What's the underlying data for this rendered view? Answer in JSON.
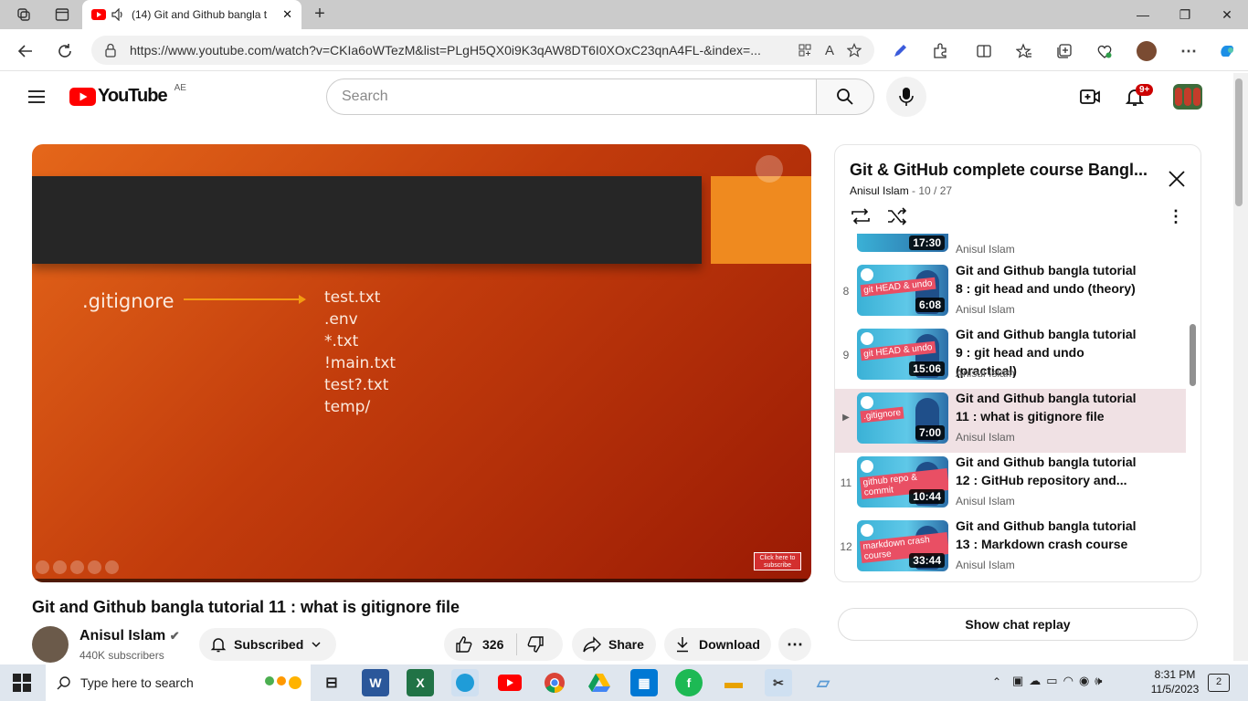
{
  "browser": {
    "tab_title": "(14) Git and Github bangla t",
    "url": "https://www.youtube.com/watch?v=CKIa6oWTezM&list=PLgH5QX0i9K3qAW8DT6I0XOxC23qnA4FL-&index=...",
    "close_tab": "✕",
    "new_tab": "+",
    "minimize": "—",
    "maximize": "❐",
    "close_window": "✕"
  },
  "youtube": {
    "logo_text": "YouTube",
    "country_code": "AE",
    "search_placeholder": "Search",
    "notification_count": "9+"
  },
  "video": {
    "slide_heading": ".gitignore",
    "slide_files": [
      "test.txt",
      ".env",
      "*.txt",
      "!main.txt",
      "test?.txt",
      "temp/"
    ],
    "subscribe_overlay": "Click here to subscribe",
    "title": "Git and Github bangla tutorial 11 : what is gitignore file",
    "channel": "Anisul Islam",
    "subscribers": "440K subscribers",
    "subscribed_label": "Subscribed",
    "likes": "326",
    "share_label": "Share",
    "download_label": "Download"
  },
  "playlist": {
    "title": "Git & GitHub complete course Bangl...",
    "owner": "Anisul Islam",
    "position": "10 / 27",
    "partial_item": {
      "duration": "17:30",
      "channel": "Anisul Islam"
    },
    "items": [
      {
        "num": "8",
        "thumb_label": "git HEAD & undo",
        "duration": "6:08",
        "title": "Git and Github bangla tutorial 8 : git head and undo (theory)",
        "channel": "Anisul Islam"
      },
      {
        "num": "9",
        "thumb_label": "git HEAD & undo",
        "duration": "15:06",
        "title": "Git and Github bangla tutorial 9 : git head and undo (practical)",
        "channel": "Anisul Islam"
      },
      {
        "num": "▶",
        "thumb_label": ".gitignore",
        "duration": "7:00",
        "title": "Git and Github bangla tutorial 11 : what is gitignore file",
        "channel": "Anisul Islam"
      },
      {
        "num": "11",
        "thumb_label": "github repo & commit",
        "duration": "10:44",
        "title": "Git and Github bangla tutorial 12 : GitHub repository and...",
        "channel": "Anisul Islam"
      },
      {
        "num": "12",
        "thumb_label": "markdown crash course",
        "duration": "33:44",
        "title": "Git and Github bangla tutorial 13 : Markdown crash course",
        "channel": "Anisul Islam"
      }
    ]
  },
  "chat_replay_label": "Show chat replay",
  "taskbar": {
    "search_placeholder": "Type here to search",
    "time": "8:31 PM",
    "date": "11/5/2023",
    "notification_count": "2"
  }
}
